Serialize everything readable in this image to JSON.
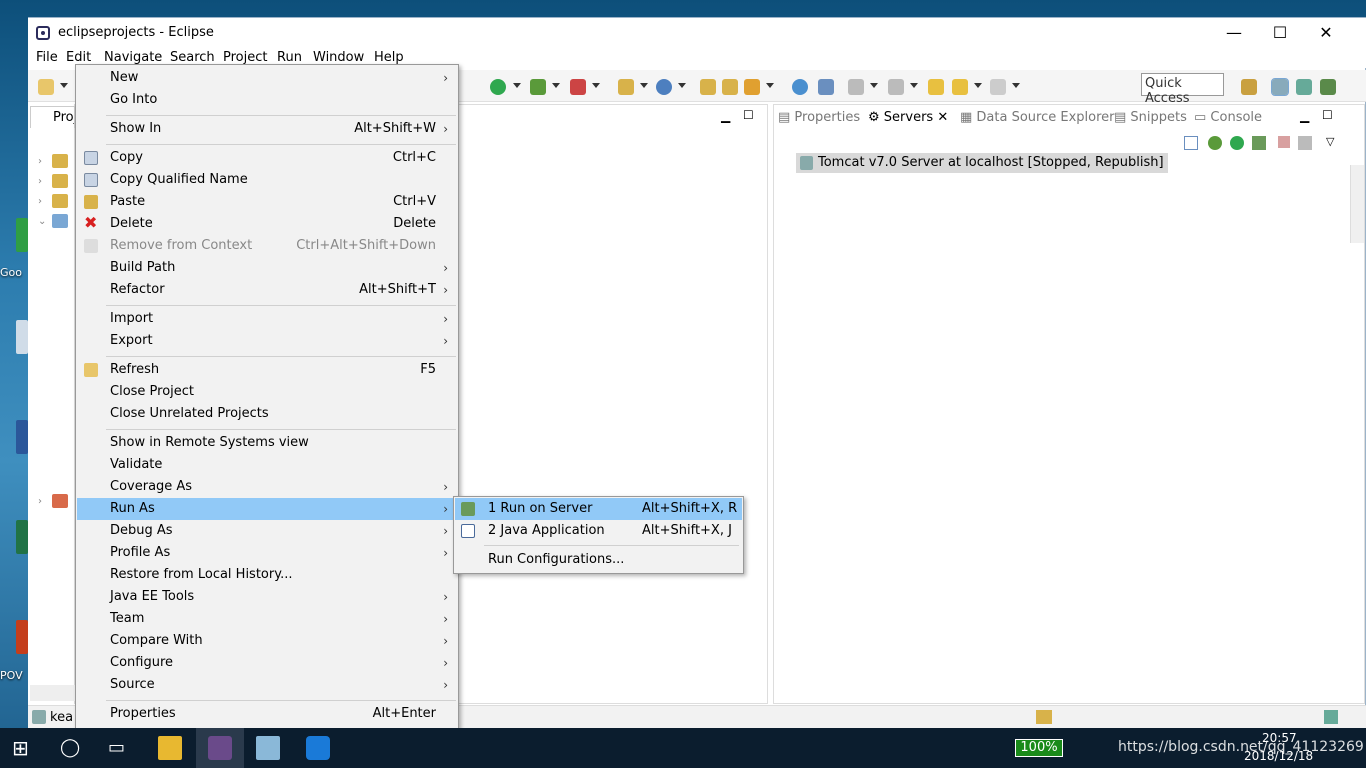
{
  "desktop": {
    "labels": [
      "Goo",
      "POV"
    ]
  },
  "window": {
    "title": "eclipseprojects - Eclipse",
    "minimize_glyph": "—",
    "maximize_glyph": "☐",
    "close_glyph": "✕"
  },
  "menubar": [
    "File",
    "Edit",
    "Navigate",
    "Search",
    "Project",
    "Run",
    "Window",
    "Help"
  ],
  "toolbar": {
    "quick_access_placeholder": "Quick Access"
  },
  "left_pane": {
    "tab_label": "Proj",
    "status_label": "kea"
  },
  "right_pane": {
    "tabs": [
      "Properties",
      "Servers",
      "Data Source Explorer",
      "Snippets",
      "Console"
    ],
    "server_entry": "Tomcat v7.0 Server at localhost  [Stopped, Republish]"
  },
  "context_menu": {
    "items": [
      {
        "label": "New",
        "accel": "",
        "submenu": true
      },
      {
        "label": "Go Into",
        "accel": "",
        "submenu": false
      },
      {
        "label": "Show In",
        "accel": "Alt+Shift+W",
        "submenu": true
      },
      {
        "label": "Copy",
        "accel": "Ctrl+C",
        "submenu": false
      },
      {
        "label": "Copy Qualified Name",
        "accel": "",
        "submenu": false
      },
      {
        "label": "Paste",
        "accel": "Ctrl+V",
        "submenu": false
      },
      {
        "label": "Delete",
        "accel": "Delete",
        "submenu": false
      },
      {
        "label": "Remove from Context",
        "accel": "Ctrl+Alt+Shift+Down",
        "submenu": false
      },
      {
        "label": "Build Path",
        "accel": "",
        "submenu": true
      },
      {
        "label": "Refactor",
        "accel": "Alt+Shift+T",
        "submenu": true
      },
      {
        "label": "Import",
        "accel": "",
        "submenu": true
      },
      {
        "label": "Export",
        "accel": "",
        "submenu": true
      },
      {
        "label": "Refresh",
        "accel": "F5",
        "submenu": false
      },
      {
        "label": "Close Project",
        "accel": "",
        "submenu": false
      },
      {
        "label": "Close Unrelated Projects",
        "accel": "",
        "submenu": false
      },
      {
        "label": "Show in Remote Systems view",
        "accel": "",
        "submenu": false
      },
      {
        "label": "Validate",
        "accel": "",
        "submenu": false
      },
      {
        "label": "Coverage As",
        "accel": "",
        "submenu": true
      },
      {
        "label": "Run As",
        "accel": "",
        "submenu": true
      },
      {
        "label": "Debug As",
        "accel": "",
        "submenu": true
      },
      {
        "label": "Profile As",
        "accel": "",
        "submenu": true
      },
      {
        "label": "Restore from Local History...",
        "accel": "",
        "submenu": false
      },
      {
        "label": "Java EE Tools",
        "accel": "",
        "submenu": true
      },
      {
        "label": "Team",
        "accel": "",
        "submenu": true
      },
      {
        "label": "Compare With",
        "accel": "",
        "submenu": true
      },
      {
        "label": "Configure",
        "accel": "",
        "submenu": true
      },
      {
        "label": "Source",
        "accel": "",
        "submenu": true
      },
      {
        "label": "Properties",
        "accel": "Alt+Enter",
        "submenu": false
      }
    ],
    "submenu_glyph": "›"
  },
  "run_as_submenu": {
    "items": [
      {
        "label": "1 Run on Server",
        "accel": "Alt+Shift+X, R"
      },
      {
        "label": "2 Java Application",
        "accel": "Alt+Shift+X, J"
      },
      {
        "label": "Run Configurations...",
        "accel": ""
      }
    ]
  },
  "taskbar": {
    "battery": "100%",
    "time": "20:57",
    "date": "2018/12/18",
    "watermark": "https://blog.csdn.net/qq_41123269"
  },
  "colors": {
    "highlight": "#91c9f7",
    "menu_bg": "#f2f2f2",
    "taskbar": "#0b1d2e"
  }
}
